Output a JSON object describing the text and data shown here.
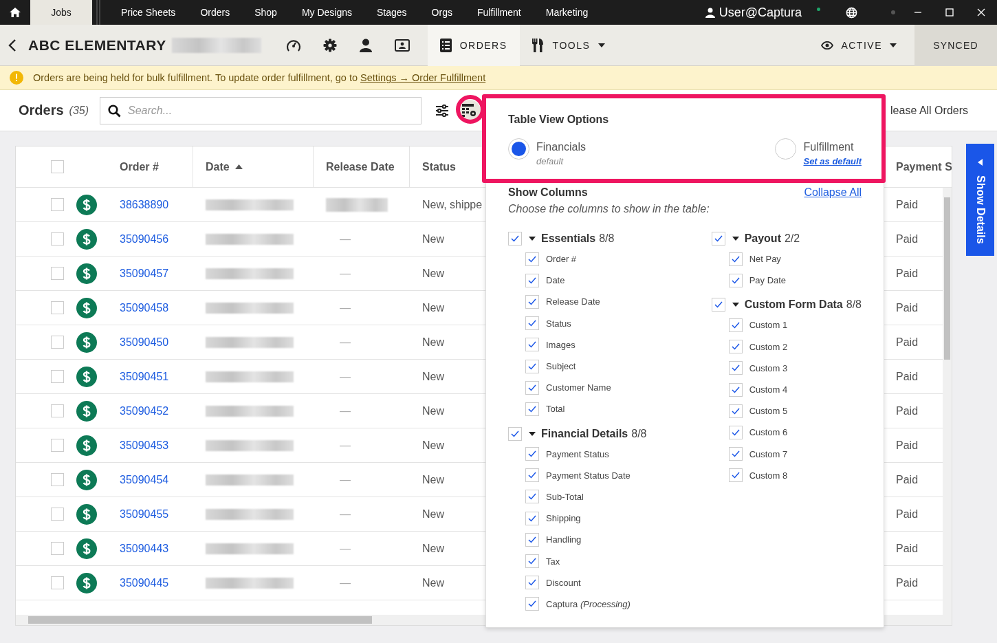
{
  "top_nav": {
    "tabs": [
      {
        "label": "Jobs",
        "selected": true
      },
      {
        "label": "Price Sheets",
        "selected": false
      },
      {
        "label": "Orders",
        "selected": false
      },
      {
        "label": "Shop",
        "selected": false
      },
      {
        "label": "My Designs",
        "selected": false
      },
      {
        "label": "Stages",
        "selected": false
      },
      {
        "label": "Orgs",
        "selected": false
      },
      {
        "label": "Fulfillment",
        "selected": false
      },
      {
        "label": "Marketing",
        "selected": false
      }
    ],
    "user": "User@Captura"
  },
  "job_bar": {
    "title": "ABC ELEMENTARY",
    "tabs": [
      {
        "label": "ORDERS",
        "selected": true,
        "kind": "orders"
      },
      {
        "label": "TOOLS",
        "selected": false,
        "kind": "tools"
      }
    ],
    "visibility": "ACTIVE",
    "sync_status": "SYNCED"
  },
  "banner": {
    "text": "Orders are being held for bulk fulfillment. To update order fulfillment, go to",
    "link": "Settings → Order Fulfillment"
  },
  "toolbar": {
    "title": "Orders",
    "count": "(35)",
    "search": {
      "placeholder": "Search..."
    },
    "action": "lease All Orders"
  },
  "table": {
    "select_all": {
      "checked": false
    },
    "columns": [
      "Order #",
      "Date",
      "Release Date",
      "Status",
      "Payment S"
    ],
    "rows": [
      {
        "order": "38638890",
        "status": "New, shippe",
        "payment": "Paid",
        "selected": false
      },
      {
        "order": "35090456",
        "release_date": "—",
        "status": "New",
        "payment": "Paid",
        "selected": false
      },
      {
        "order": "35090457",
        "release_date": "—",
        "status": "New",
        "payment": "Paid",
        "selected": false
      },
      {
        "order": "35090458",
        "release_date": "—",
        "status": "New",
        "payment": "Paid",
        "selected": false
      },
      {
        "order": "35090450",
        "release_date": "—",
        "status": "New",
        "payment": "Paid",
        "selected": false
      },
      {
        "order": "35090451",
        "release_date": "—",
        "status": "New",
        "payment": "Paid",
        "selected": false
      },
      {
        "order": "35090452",
        "release_date": "—",
        "status": "New",
        "payment": "Paid",
        "selected": false
      },
      {
        "order": "35090453",
        "release_date": "—",
        "status": "New",
        "payment": "Paid",
        "selected": false
      },
      {
        "order": "35090454",
        "release_date": "—",
        "status": "New",
        "payment": "Paid",
        "selected": false
      },
      {
        "order": "35090455",
        "release_date": "—",
        "status": "New",
        "payment": "Paid",
        "selected": false
      },
      {
        "order": "35090443",
        "release_date": "—",
        "status": "New",
        "payment": "Paid",
        "selected": false
      },
      {
        "order": "35090445",
        "release_date": "—",
        "status": "New",
        "payment": "Paid",
        "selected": false
      }
    ]
  },
  "side_tab": "Show Details",
  "view_options": {
    "title": "Table View Options",
    "views": [
      {
        "label": "Financials",
        "note": "default",
        "selected": true
      },
      {
        "label": "Fulfillment",
        "link": "Set as default",
        "selected": false
      }
    ],
    "show_columns": {
      "title": "Show Columns",
      "collapse": "Collapse All",
      "hint": "Choose the columns to show in the table:",
      "columns": [
        [
          {
            "label": "Essentials",
            "count": "8/8",
            "checked": true,
            "expanded": true,
            "items": [
              {
                "label": "Order #",
                "checked": true
              },
              {
                "label": "Date",
                "checked": true
              },
              {
                "label": "Release Date",
                "checked": true
              },
              {
                "label": "Status",
                "checked": true
              },
              {
                "label": "Images",
                "checked": true
              },
              {
                "label": "Subject",
                "checked": true
              },
              {
                "label": "Customer Name",
                "checked": true
              },
              {
                "label": "Total",
                "checked": true
              }
            ]
          },
          {
            "label": "Financial Details",
            "count": "8/8",
            "checked": true,
            "expanded": true,
            "items": [
              {
                "label": "Payment Status",
                "checked": true
              },
              {
                "label": "Payment Status Date",
                "checked": true
              },
              {
                "label": "Sub-Total",
                "checked": true
              },
              {
                "label": "Shipping",
                "checked": true
              },
              {
                "label": "Handling",
                "checked": true
              },
              {
                "label": "Tax",
                "checked": true
              },
              {
                "label": "Discount",
                "checked": true
              },
              {
                "label": "Captura *(Processing)*",
                "checked": true
              }
            ]
          }
        ],
        [
          {
            "label": "Payout",
            "count": "2/2",
            "checked": true,
            "expanded": true,
            "items": [
              {
                "label": "Net Pay",
                "checked": true
              },
              {
                "label": "Pay Date",
                "checked": true
              }
            ]
          },
          {
            "label": "Custom Form Data",
            "count": "8/8",
            "checked": true,
            "expanded": true,
            "items": [
              {
                "label": "Custom 1",
                "checked": true
              },
              {
                "label": "Custom 2",
                "checked": true
              },
              {
                "label": "Custom 3",
                "checked": true
              },
              {
                "label": "Custom 4",
                "checked": true
              },
              {
                "label": "Custom 5",
                "checked": true
              },
              {
                "label": "Custom 6",
                "checked": true
              },
              {
                "label": "Custom 7",
                "checked": true
              },
              {
                "label": "Custom 8",
                "checked": true
              }
            ]
          }
        ]
      ]
    }
  }
}
